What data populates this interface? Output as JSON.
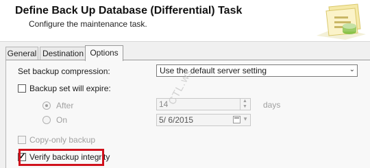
{
  "header": {
    "title": "Define Back Up Database (Differential) Task",
    "subtitle": "Configure the maintenance task."
  },
  "tabs": [
    {
      "label": "General",
      "active": false
    },
    {
      "label": "Destination",
      "active": false
    },
    {
      "label": "Options",
      "active": true
    }
  ],
  "options": {
    "compression_label": "Set backup compression:",
    "compression_value": "Use the default server setting",
    "expire_label": "Backup set will expire:",
    "expire_checked": false,
    "after_label": "After",
    "after_selected": true,
    "days_value": "14",
    "days_unit": "days",
    "on_label": "On",
    "on_selected": false,
    "date_value": "5/ 6/2015",
    "copy_only_label": "Copy-only backup",
    "copy_only_checked": false,
    "verify_label": "Verify backup integrity",
    "verify_checked": true
  },
  "watermark": "CTL.ws",
  "colors": {
    "highlight": "#d0101b",
    "background": "#f0f0f0"
  }
}
